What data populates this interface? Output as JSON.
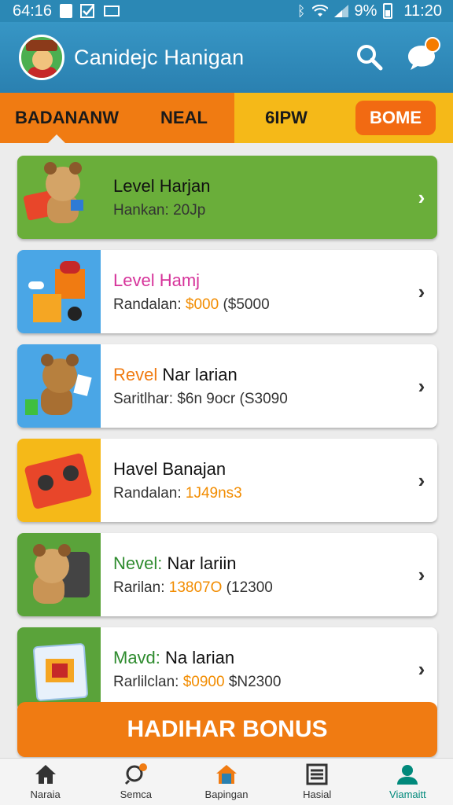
{
  "status_bar": {
    "time_left": "64:16",
    "battery": "9%",
    "time_right": "11:20"
  },
  "app": {
    "title": "Canidejc Hanigan"
  },
  "tabs": [
    {
      "label": "BADANANW"
    },
    {
      "label": "NEAL"
    },
    {
      "label": "6IPW"
    },
    {
      "label": "BOME"
    }
  ],
  "cards": [
    {
      "title": "Level Harjan",
      "sub_label": "Hankan:",
      "price": "",
      "extra": "20Jp"
    },
    {
      "title": "Level Hamj",
      "sub_label": "Randalan:",
      "price": "$000",
      "extra": "($5000"
    },
    {
      "title_a": "Revel",
      "title_b": "Nar larian",
      "sub_label": "Saritlhar:",
      "price": "",
      "extra": "$6n 9ocr (S3090"
    },
    {
      "title": "Havel Banajan",
      "sub_label": "Randalan:",
      "price": "1J49ns3",
      "extra": ""
    },
    {
      "title_a": "Nevel:",
      "title_b": "Nar lariin",
      "sub_label": "Rarilan:",
      "price": "13807O",
      "extra": "(12300"
    },
    {
      "title_a": "Mavd:",
      "title_b": "Na larian",
      "sub_label": "Rarlilclan:",
      "price": "$0900",
      "extra": "$N2300"
    }
  ],
  "bonus_button": "HADIHAR BONUS",
  "bottom_nav": [
    {
      "label": "Naraia",
      "icon": "home-icon"
    },
    {
      "label": "Semca",
      "icon": "search-icon"
    },
    {
      "label": "Bapingan",
      "icon": "house-icon"
    },
    {
      "label": "Hasial",
      "icon": "list-icon"
    },
    {
      "label": "Viamaitt",
      "icon": "person-icon"
    }
  ],
  "colors": {
    "appbar": "#2a80b0",
    "orange": "#f07b12",
    "yellow": "#f5b918",
    "green": "#6aae3a",
    "price": "#f28c00",
    "active_nav": "#00897b"
  }
}
